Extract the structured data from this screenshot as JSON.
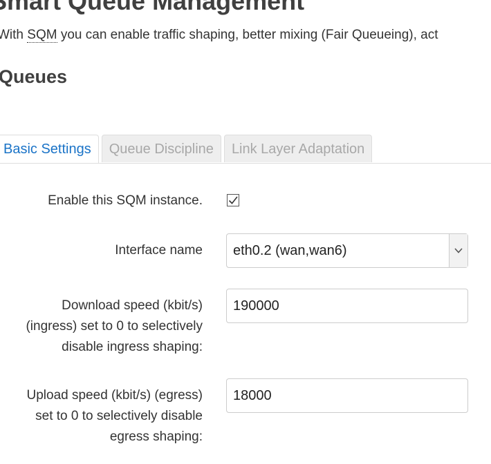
{
  "header": {
    "title": "Smart Queue Management",
    "desc_prefix": "With ",
    "desc_abbr": "SQM",
    "desc_suffix": " you can enable traffic shaping, better mixing (Fair Queueing), act"
  },
  "section": {
    "title": "Queues"
  },
  "tabs": [
    {
      "label": "Basic Settings",
      "active": true
    },
    {
      "label": "Queue Discipline",
      "active": false
    },
    {
      "label": "Link Layer Adaptation",
      "active": false
    }
  ],
  "form": {
    "enable": {
      "label": "Enable this SQM instance.",
      "checked": true
    },
    "interface": {
      "label": "Interface name",
      "value": "eth0.2 (wan,wan6)"
    },
    "download": {
      "label_lines": [
        "Download speed (kbit/s)",
        "(ingress) set to 0 to selectively",
        "disable ingress shaping:"
      ],
      "value": "190000"
    },
    "upload": {
      "label_lines": [
        "Upload speed (kbit/s) (egress)",
        "set to 0 to selectively disable",
        "egress shaping:"
      ],
      "value": "18000"
    }
  },
  "colors": {
    "tab_active": "#1a73c7",
    "tab_inactive": "#a8a8a8",
    "heading": "#404040"
  }
}
